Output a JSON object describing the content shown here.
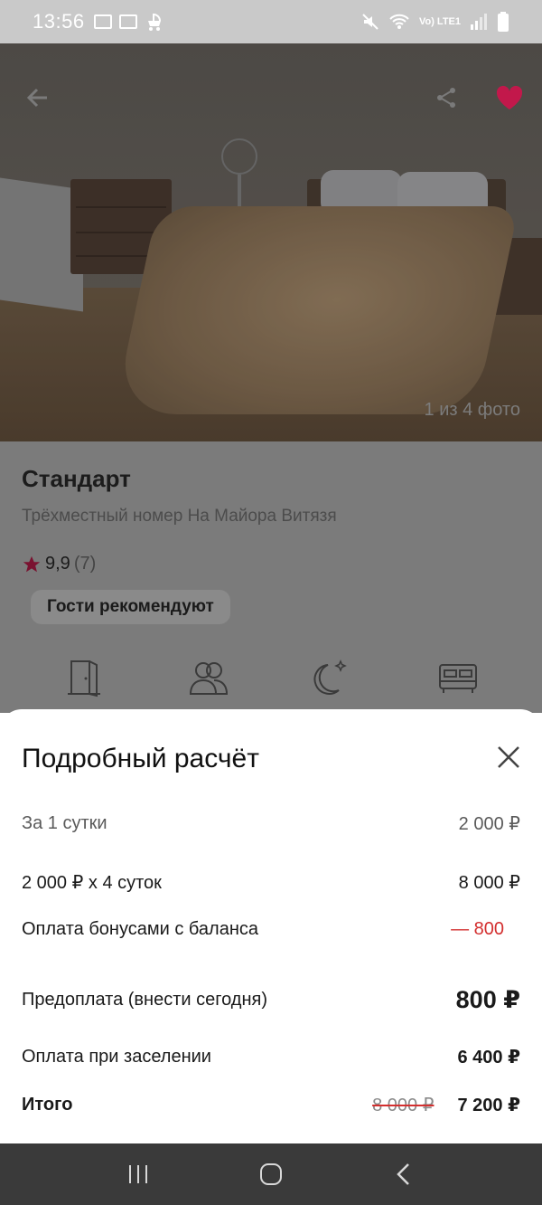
{
  "status_bar": {
    "time": "13:56",
    "network": "Vo) LTE1"
  },
  "photo": {
    "counter": "1 из 4 фото",
    "dots_total": 4,
    "active_dot": 1
  },
  "room": {
    "title": "Стандарт",
    "subtitle": "Трёхместный номер На Майора Витязя",
    "rating": "9,9",
    "reviews": "(7)",
    "badge": "Гости рекомендуют"
  },
  "amenities": [
    "door-icon",
    "guests-icon",
    "night-icon",
    "bed-icon"
  ],
  "sheet": {
    "title": "Подробный расчёт",
    "rows": [
      {
        "label": "За 1 сутки",
        "value": "2 000 ₽"
      },
      {
        "label": "2 000 ₽ x 4 суток",
        "value": "8 000 ₽"
      },
      {
        "label": "Оплата бонусами с баланса",
        "value": "— 800"
      },
      {
        "label": "Предоплата (внести сегодня)",
        "value": "800 ₽"
      },
      {
        "label": "Оплата при заселении",
        "value": "6 400 ₽"
      }
    ],
    "total": {
      "label": "Итого",
      "old_value": "8 000 ₽",
      "value": "7 200 ₽"
    }
  },
  "colors": {
    "accent_red": "#d32f2f",
    "heart_red": "#c2184b",
    "nav_bg": "#3a3a3a"
  }
}
